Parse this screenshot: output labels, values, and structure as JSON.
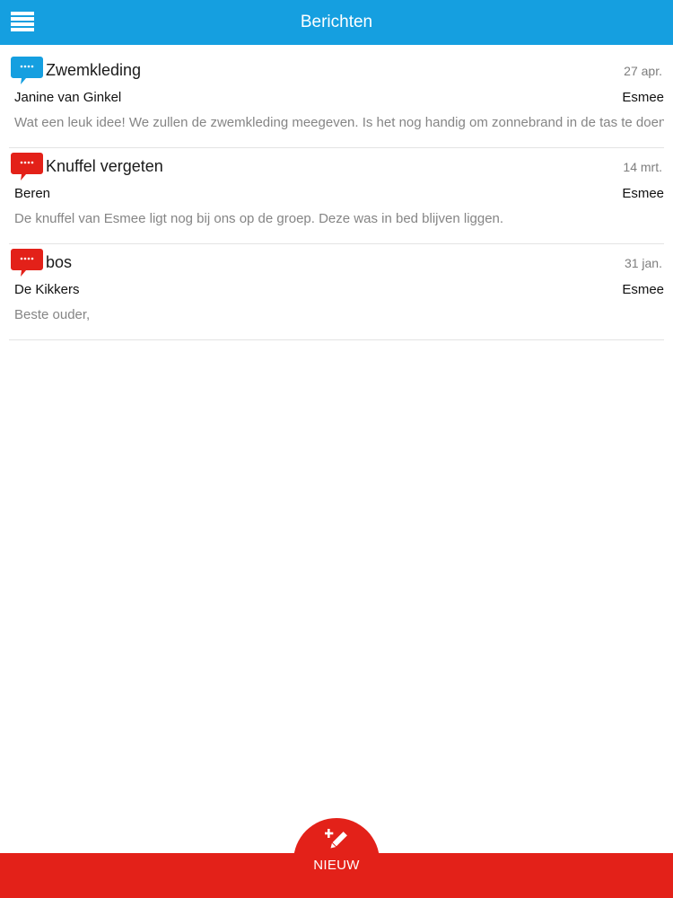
{
  "header": {
    "title": "Berichten",
    "menu_icon": "hamburger-menu-icon"
  },
  "messages": [
    {
      "subject": "Zwemkleding",
      "date": "27 apr.",
      "sender": "Janine van Ginkel",
      "recipient": "Esmee",
      "preview": "Wat een leuk idee! We zullen de zwemkleding meegeven. Is het nog handig om zonnebrand in de tas te doen?",
      "icon": "speech-bubble-icon",
      "icon_color": "#159fe0"
    },
    {
      "subject": "Knuffel vergeten",
      "date": "14 mrt.",
      "sender": "Beren",
      "recipient": "Esmee",
      "preview": "De knuffel van Esmee ligt nog bij ons op de groep. Deze was in bed blijven liggen.",
      "icon": "speech-bubble-icon",
      "icon_color": "#e32119"
    },
    {
      "subject": "bos",
      "date": "31 jan.",
      "sender": "De Kikkers",
      "recipient": "Esmee",
      "preview": "Beste ouder,",
      "icon": "speech-bubble-icon",
      "icon_color": "#e32119"
    }
  ],
  "footer": {
    "new_label": "NIEUW",
    "new_icon": "compose-pencil-icon"
  },
  "colors": {
    "header_blue": "#159fe0",
    "footer_red": "#e32119",
    "unread_blue": "#159fe0",
    "read_red": "#e32119"
  }
}
